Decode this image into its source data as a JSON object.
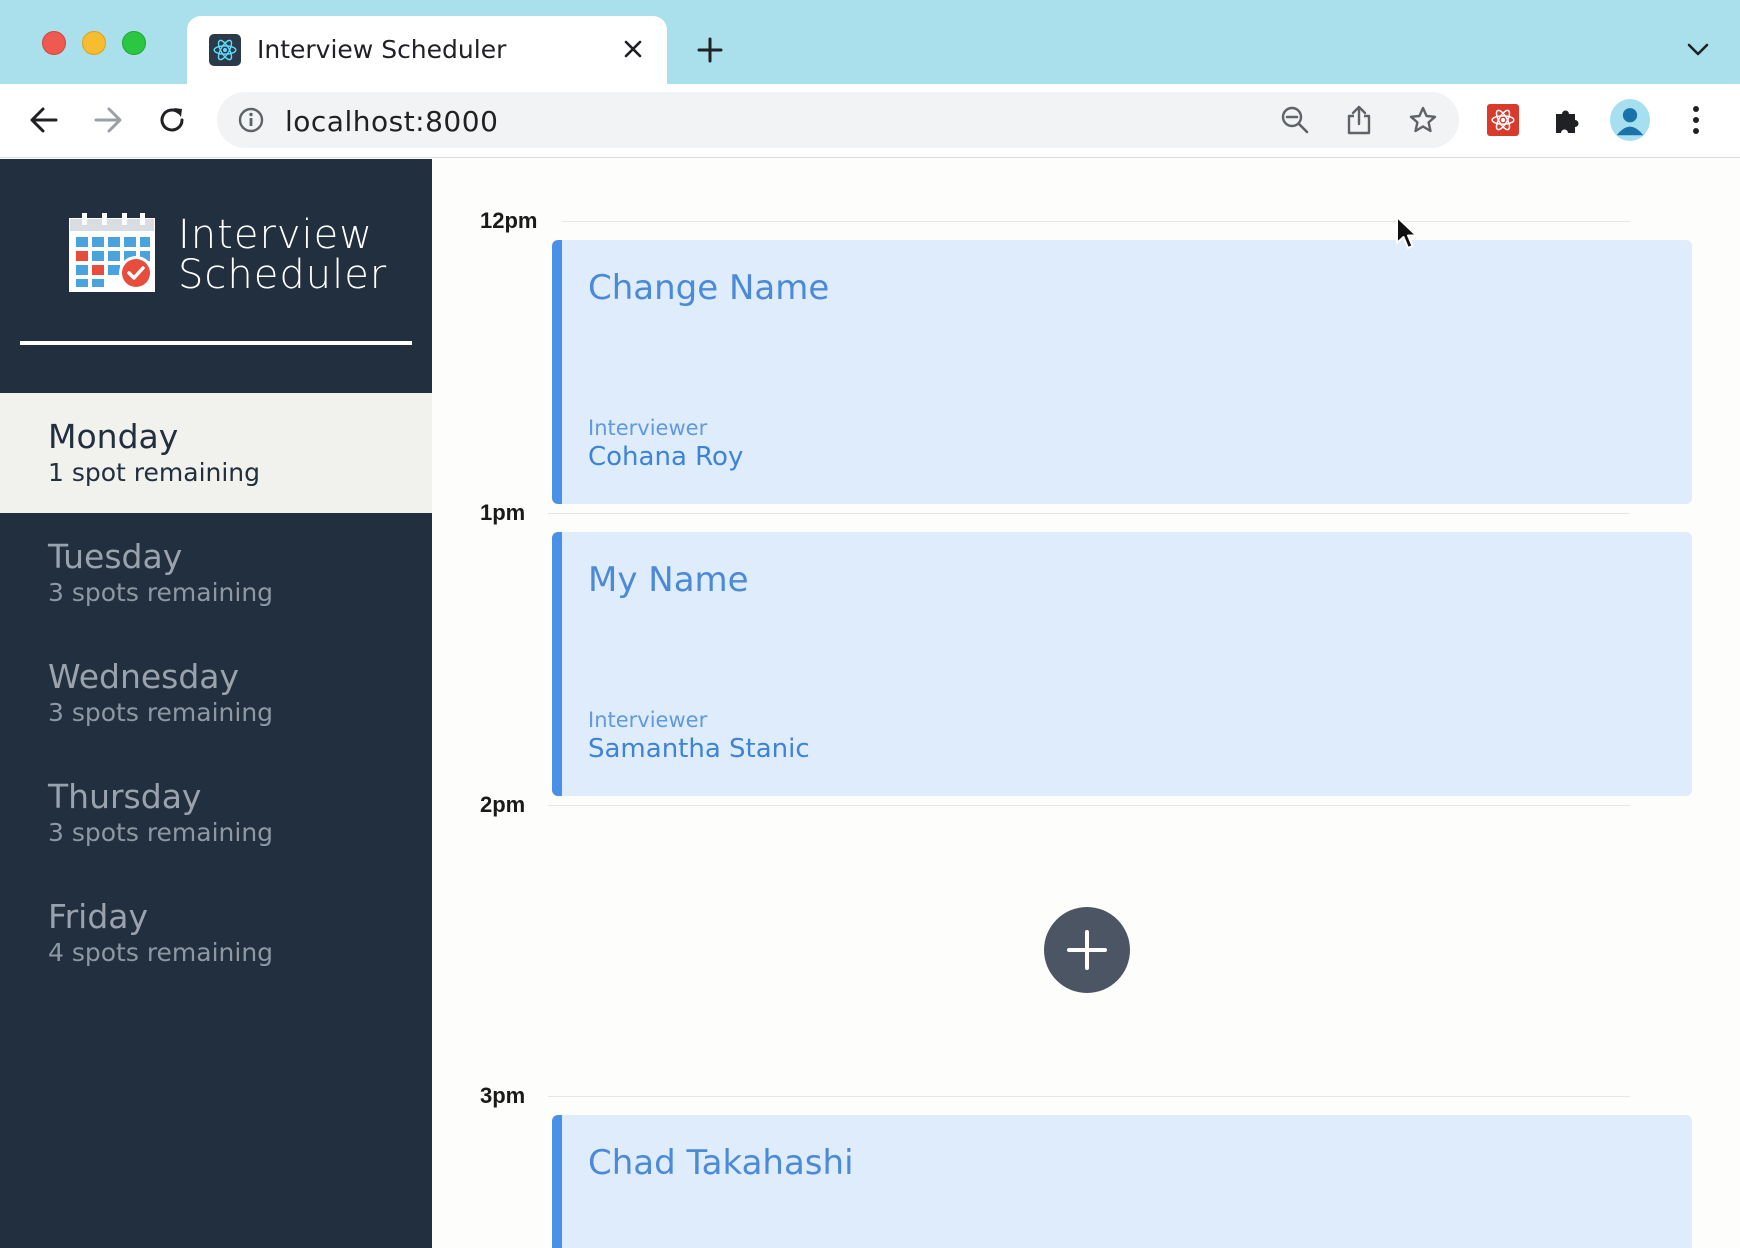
{
  "browser": {
    "tab_title": "Interview Scheduler",
    "url": "localhost:8000",
    "icons": {
      "back": "back-arrow-icon",
      "forward": "forward-arrow-icon",
      "reload": "reload-icon",
      "info": "info-icon",
      "zoom": "zoom-out-icon",
      "share": "share-icon",
      "bookmark": "star-icon",
      "react_devtools": "react-devtools-icon",
      "extensions": "puzzle-icon",
      "profile": "avatar-icon",
      "menu": "kebab-menu-icon"
    }
  },
  "app": {
    "logo_line1": "Interview",
    "logo_line2": "Scheduler",
    "days": [
      {
        "name": "Monday",
        "spots": "1 spot remaining",
        "selected": true
      },
      {
        "name": "Tuesday",
        "spots": "3 spots remaining",
        "selected": false
      },
      {
        "name": "Wednesday",
        "spots": "3 spots remaining",
        "selected": false
      },
      {
        "name": "Thursday",
        "spots": "3 spots remaining",
        "selected": false
      },
      {
        "name": "Friday",
        "spots": "4 spots remaining",
        "selected": false
      }
    ],
    "appointments": [
      {
        "time": "12pm",
        "student": "Change Name",
        "interviewer_label": "Interviewer",
        "interviewer": "Cohana Roy"
      },
      {
        "time": "1pm",
        "student": "My Name",
        "interviewer_label": "Interviewer",
        "interviewer": "Samantha Stanic"
      },
      {
        "time": "2pm"
      },
      {
        "time": "3pm",
        "student": "Chad Takahashi"
      }
    ]
  },
  "colors": {
    "sidebar": "#222f3e",
    "card_bg": "#dfecfc",
    "card_accent": "#4a90e6",
    "add_button": "#4b5563"
  }
}
